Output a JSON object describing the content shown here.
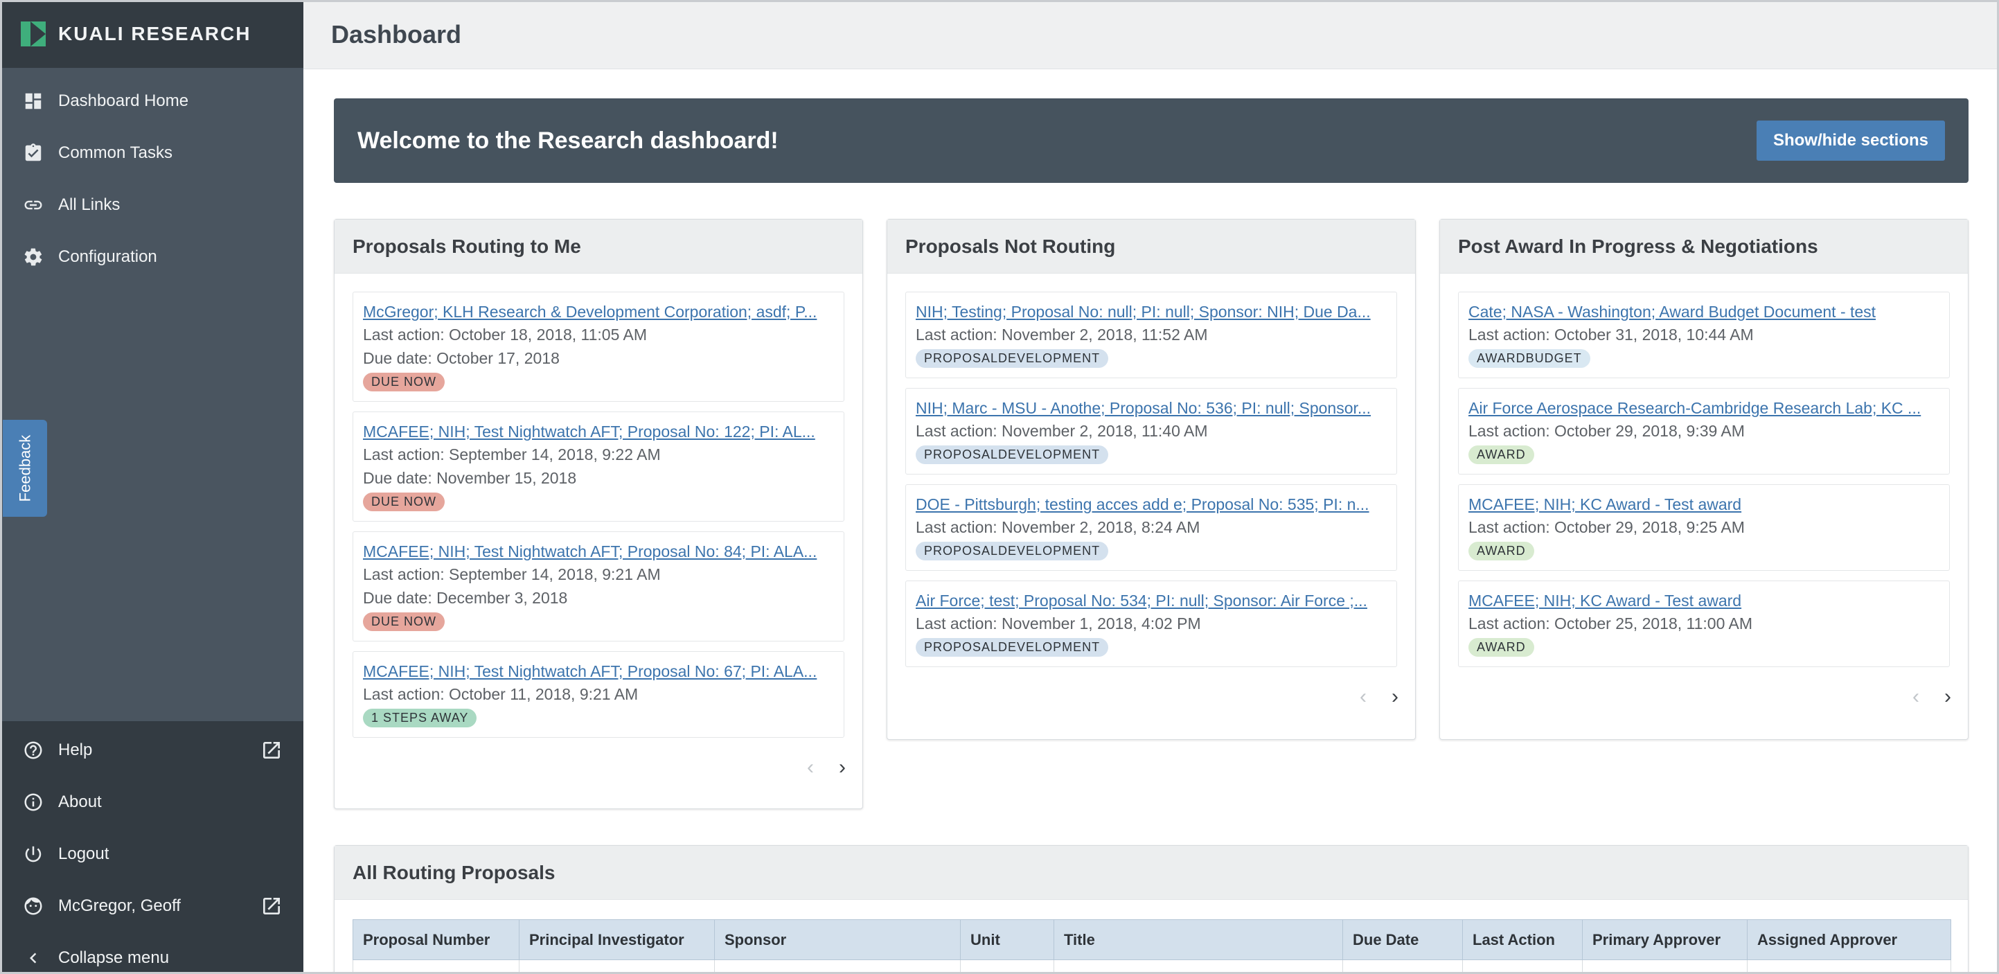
{
  "sidebar": {
    "brand": "KUALI RESEARCH",
    "items": [
      {
        "label": "Dashboard Home",
        "icon": "dashboard-icon"
      },
      {
        "label": "Common Tasks",
        "icon": "clipboard-check-icon"
      },
      {
        "label": "All Links",
        "icon": "link-icon"
      },
      {
        "label": "Configuration",
        "icon": "gear-icon"
      }
    ],
    "bottom": [
      {
        "label": "Help",
        "icon": "help-icon"
      },
      {
        "label": "About",
        "icon": "info-icon"
      },
      {
        "label": "Logout",
        "icon": "power-icon"
      },
      {
        "label": "McGregor, Geoff",
        "icon": "user-icon"
      },
      {
        "label": "Collapse menu",
        "icon": "chevron-left-icon"
      }
    ]
  },
  "feedback": "Feedback",
  "header": {
    "title": "Dashboard"
  },
  "welcome": {
    "title": "Welcome to the Research dashboard!",
    "button": "Show/hide sections"
  },
  "cards": {
    "routing_to_me": {
      "title": "Proposals Routing to Me",
      "items": [
        {
          "link": "McGregor; KLH Research & Development Corporation; asdf; P...",
          "last": "Last action: October 18, 2018, 11:05 AM",
          "due": "Due date: October 17, 2018",
          "badge": "DUE NOW"
        },
        {
          "link": "MCAFEE; NIH; Test Nightwatch AFT; Proposal No: 122; PI: AL...",
          "last": "Last action: September 14, 2018, 9:22 AM",
          "due": "Due date: November 15, 2018",
          "badge": "DUE NOW"
        },
        {
          "link": "MCAFEE; NIH; Test Nightwatch AFT; Proposal No: 84; PI: ALA...",
          "last": "Last action: September 14, 2018, 9:21 AM",
          "due": "Due date: December 3, 2018",
          "badge": "DUE NOW"
        },
        {
          "link": "MCAFEE; NIH; Test Nightwatch AFT; Proposal No: 67; PI: ALA...",
          "last": "Last action: October 11, 2018, 9:21 AM",
          "badge": "1 STEPS AWAY"
        }
      ]
    },
    "not_routing": {
      "title": "Proposals Not Routing",
      "items": [
        {
          "link": "NIH; Testing; Proposal No: null; PI: null; Sponsor: NIH; Due Da...",
          "last": "Last action: November 2, 2018, 11:52 AM",
          "badge": "PROPOSALDEVELOPMENT"
        },
        {
          "link": "NIH; Marc - MSU - Anothe; Proposal No: 536; PI: null; Sponsor...",
          "last": "Last action: November 2, 2018, 11:40 AM",
          "badge": "PROPOSALDEVELOPMENT"
        },
        {
          "link": "DOE - Pittsburgh; testing acces add e; Proposal No: 535; PI: n...",
          "last": "Last action: November 2, 2018, 8:24 AM",
          "badge": "PROPOSALDEVELOPMENT"
        },
        {
          "link": "Air Force; test; Proposal No: 534; PI: null; Sponsor: Air Force ;...",
          "last": "Last action: November 1, 2018, 4:02 PM",
          "badge": "PROPOSALDEVELOPMENT"
        }
      ]
    },
    "post_award": {
      "title": "Post Award In Progress & Negotiations",
      "items": [
        {
          "link": "Cate; NASA - Washington; Award Budget Document - test",
          "last": "Last action: October 31, 2018, 10:44 AM",
          "badge": "AWARDBUDGET"
        },
        {
          "link": "Air Force Aerospace Research-Cambridge Research Lab; KC ...",
          "last": "Last action: October 29, 2018, 9:39 AM",
          "badge": "AWARD"
        },
        {
          "link": "MCAFEE; NIH; KC Award - Test award",
          "last": "Last action: October 29, 2018, 9:25 AM",
          "badge": "AWARD"
        },
        {
          "link": "MCAFEE; NIH; KC Award - Test award",
          "last": "Last action: October 25, 2018, 11:00 AM",
          "badge": "AWARD"
        }
      ]
    }
  },
  "all_routing": {
    "title": "All Routing Proposals",
    "columns": [
      "Proposal Number",
      "Principal Investigator",
      "Sponsor",
      "Unit",
      "Title",
      "Due Date",
      "Last Action",
      "Primary Approver",
      "Assigned Approver"
    ]
  },
  "pager": {
    "prev": "‹",
    "next": "›"
  }
}
